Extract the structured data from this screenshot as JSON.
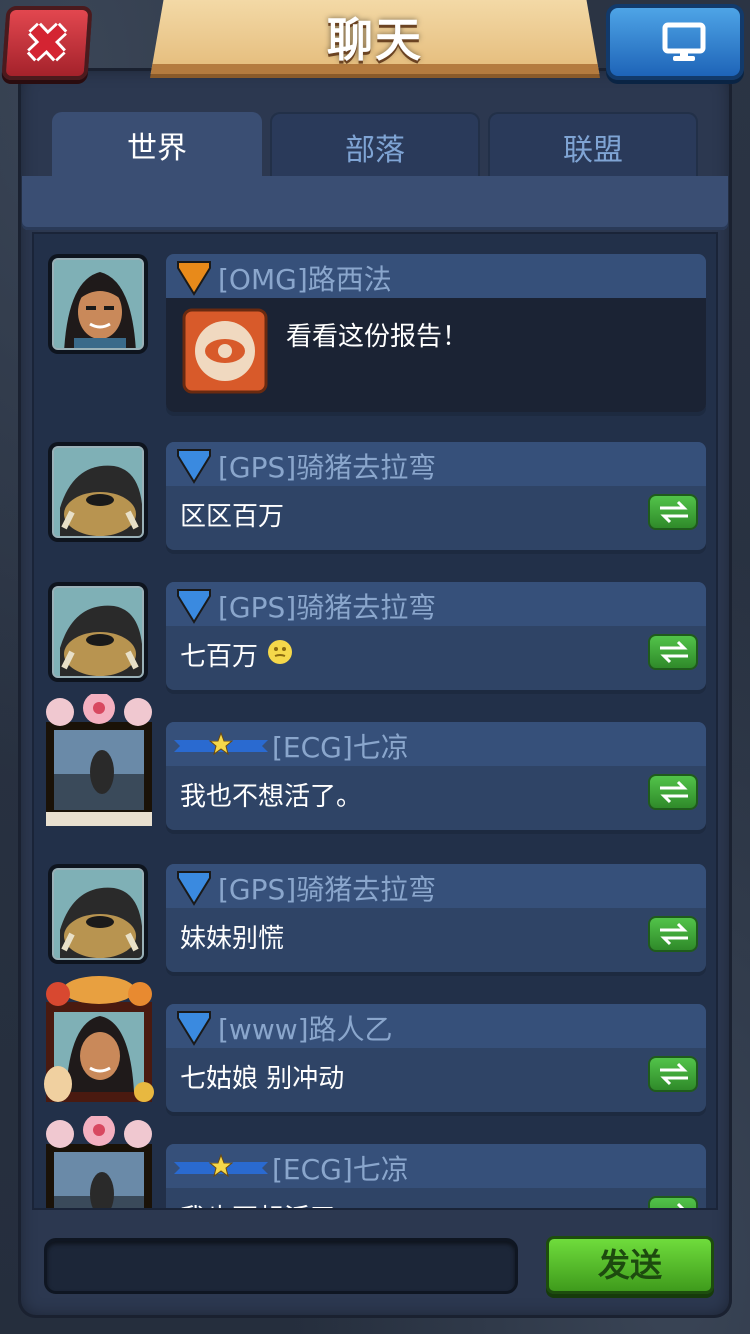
{
  "header": {
    "title": "聊天",
    "close_icon": "close-x-icon",
    "screen_icon": "monitor-icon"
  },
  "tabs": [
    {
      "label": "世界",
      "active": true
    },
    {
      "label": "部落",
      "active": false
    },
    {
      "label": "联盟",
      "active": false
    }
  ],
  "messages": [
    {
      "name": "[OMG]路西法",
      "text": "看看这份报告！",
      "badge": "orange-shield",
      "avatar": "warrior-avatar",
      "type": "report"
    },
    {
      "name": "[GPS]骑猪去拉弯",
      "text": "区区百万",
      "badge": "blue-shield",
      "avatar": "boar-avatar"
    },
    {
      "name": "[GPS]骑猪去拉弯",
      "text": "七百万",
      "badge": "blue-shield",
      "avatar": "boar-avatar",
      "emoji": "smiley-emoji"
    },
    {
      "name": "[ECG]七凉",
      "text": "我也不想活了。",
      "badge": "star-ribbon",
      "avatar": "photo-avatar"
    },
    {
      "name": "[GPS]骑猪去拉弯",
      "text": "妹妹别慌",
      "badge": "blue-shield",
      "avatar": "boar-avatar"
    },
    {
      "name": "[www]路人乙",
      "text": "七姑娘 别冲动",
      "badge": "blue-shield",
      "avatar": "warrior-avatar"
    },
    {
      "name": "[ECG]七凉",
      "text": "我也不想活了",
      "badge": "star-ribbon",
      "avatar": "photo-avatar"
    }
  ],
  "input": {
    "value": ""
  },
  "send_label": "发送",
  "colors": {
    "panel": "#2c3850",
    "tab_active": "#3a4e73",
    "name_text": "#8aa6cc",
    "send_green": "#4fb82a",
    "close_red": "#c8303a",
    "screen_blue": "#2f7fd0"
  }
}
